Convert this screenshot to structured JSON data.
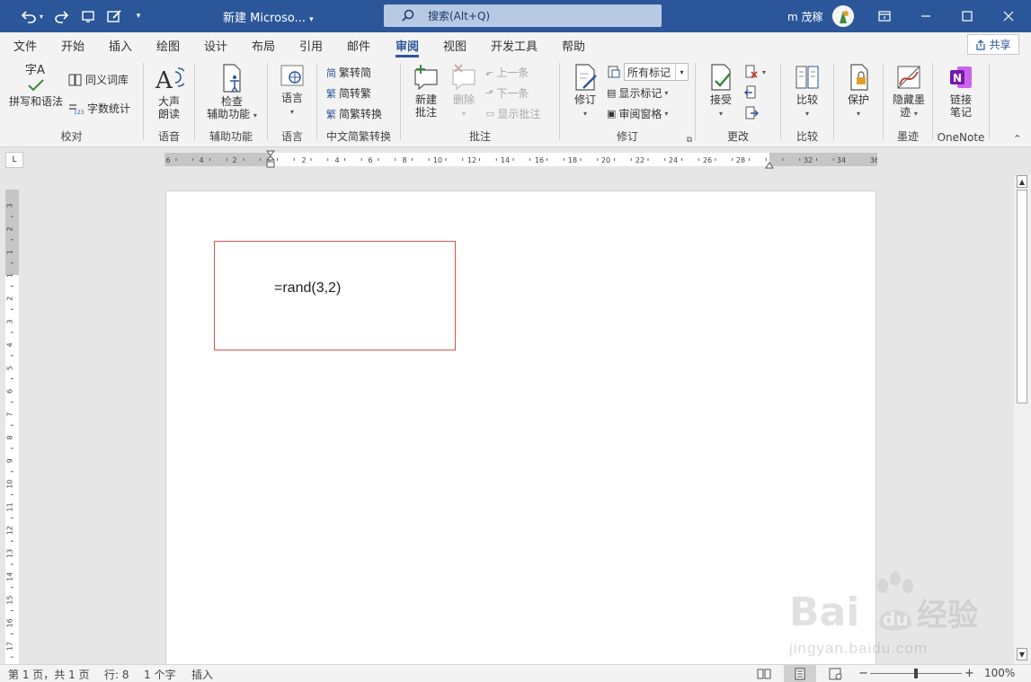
{
  "titlebar": {
    "doc_title": "新建 Microso...",
    "search_placeholder": "搜索(Alt+Q)",
    "user_name": "m 茂稼"
  },
  "tabs": [
    {
      "label": "文件"
    },
    {
      "label": "开始"
    },
    {
      "label": "插入"
    },
    {
      "label": "绘图"
    },
    {
      "label": "设计"
    },
    {
      "label": "布局"
    },
    {
      "label": "引用"
    },
    {
      "label": "邮件"
    },
    {
      "label": "审阅",
      "active": true
    },
    {
      "label": "视图"
    },
    {
      "label": "开发工具"
    },
    {
      "label": "帮助"
    }
  ],
  "share_label": "共享",
  "ribbon": {
    "proofing": {
      "label": "校对",
      "spelling": "拼写和语法",
      "thesaurus": "同义词库",
      "word_count": "字数统计",
      "spelling_icon_text": "字A"
    },
    "speech": {
      "label": "语音",
      "read_aloud_1": "大声",
      "read_aloud_2": "朗读"
    },
    "accessibility": {
      "label": "辅助功能",
      "check_1": "检查",
      "check_2": "辅助功能"
    },
    "language": {
      "label": "语言",
      "language_btn": "语言"
    },
    "chinese": {
      "label": "中文简繁转换",
      "to_simplified": "繁转简",
      "to_traditional": "简转繁",
      "convert": "简繁转换"
    },
    "comments": {
      "label": "批注",
      "new_1": "新建",
      "new_2": "批注",
      "delete": "删除",
      "previous": "上一条",
      "next": "下一条",
      "show": "显示批注"
    },
    "tracking": {
      "label": "修订",
      "track_changes": "修订",
      "markup_select": "所有标记",
      "show_markup": "显示标记",
      "reviewing_pane": "审阅窗格"
    },
    "changes": {
      "label": "更改",
      "accept": "接受"
    },
    "compare": {
      "label": "比较",
      "compare_btn": "比较"
    },
    "protect": {
      "label": "",
      "protect_btn": "保护"
    },
    "ink": {
      "label": "墨迹",
      "hide_1": "隐藏墨",
      "hide_2": "迹"
    },
    "onenote": {
      "label": "OneNote",
      "link_1": "链接",
      "link_2": "笔记"
    }
  },
  "ruler": {
    "corner": "L",
    "h_ticks": [
      "6",
      "4",
      "2",
      "2",
      "4",
      "6",
      "8",
      "10",
      "12",
      "14",
      "16",
      "18",
      "20",
      "22",
      "24",
      "26",
      "28",
      "32",
      "34",
      "36"
    ],
    "v_ticks": [
      "3",
      "2",
      "1",
      "1",
      "2",
      "3",
      "4",
      "5",
      "6",
      "7",
      "8",
      "9",
      "10",
      "11",
      "12",
      "13",
      "14",
      "15",
      "16",
      "17"
    ]
  },
  "document": {
    "formula_text": "=rand(3,2)"
  },
  "statusbar": {
    "page": "第 1 页，共 1 页",
    "line": "行: 8",
    "words": "1 个字",
    "mode": "插入",
    "zoom": "100%"
  },
  "watermark": {
    "url": "jingyan.baidu.com"
  },
  "colors": {
    "accent": "#2b579a",
    "textbox_border": "#d9534f"
  }
}
